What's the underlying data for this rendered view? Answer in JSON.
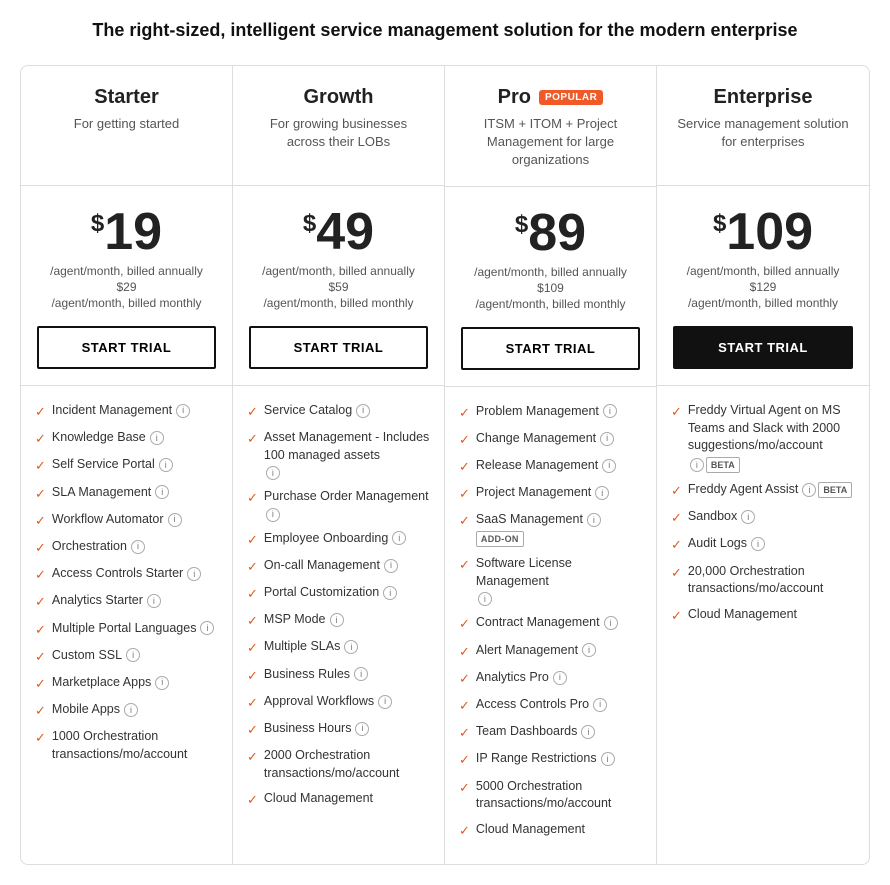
{
  "page": {
    "title": "The right-sized, intelligent service management solution for the modern enterprise"
  },
  "plans": [
    {
      "id": "starter",
      "name": "Starter",
      "popular": false,
      "desc": "For getting started",
      "price": "19",
      "billing_annual": "/agent/month, billed annually",
      "price_monthly": "$29",
      "billing_monthly": "/agent/month, billed monthly",
      "cta": "START TRIAL",
      "cta_dark": false,
      "features": [
        {
          "text": "Incident Management",
          "info": true
        },
        {
          "text": "Knowledge Base",
          "info": true
        },
        {
          "text": "Self Service Portal",
          "info": true
        },
        {
          "text": "SLA Management",
          "info": true
        },
        {
          "text": "Workflow Automator",
          "info": true
        },
        {
          "text": "Orchestration",
          "info": true
        },
        {
          "text": "Access Controls Starter",
          "info": true
        },
        {
          "text": "Analytics Starter",
          "info": true
        },
        {
          "text": "Multiple Portal Languages",
          "info": true
        },
        {
          "text": "Custom SSL",
          "info": true
        },
        {
          "text": "Marketplace Apps",
          "info": true
        },
        {
          "text": "Mobile Apps",
          "info": true
        },
        {
          "text": "1000 Orchestration transactions/mo/account",
          "info": false
        }
      ]
    },
    {
      "id": "growth",
      "name": "Growth",
      "popular": false,
      "desc": "For growing businesses across their LOBs",
      "price": "49",
      "billing_annual": "/agent/month, billed annually",
      "price_monthly": "$59",
      "billing_monthly": "/agent/month, billed monthly",
      "cta": "START TRIAL",
      "cta_dark": false,
      "features": [
        {
          "text": "Service Catalog",
          "info": true
        },
        {
          "text": "Asset Management - Includes 100 managed assets",
          "info": true
        },
        {
          "text": "Purchase Order Management",
          "info": true
        },
        {
          "text": "Employee Onboarding",
          "info": true
        },
        {
          "text": "On-call Management",
          "info": true
        },
        {
          "text": "Portal Customization",
          "info": true
        },
        {
          "text": "MSP Mode",
          "info": true
        },
        {
          "text": "Multiple SLAs",
          "info": true
        },
        {
          "text": "Business Rules",
          "info": true
        },
        {
          "text": "Approval Workflows",
          "info": true
        },
        {
          "text": "Business Hours",
          "info": true
        },
        {
          "text": "2000 Orchestration transactions/mo/account",
          "info": false
        },
        {
          "text": "Cloud Management",
          "info": false
        }
      ]
    },
    {
      "id": "pro",
      "name": "Pro",
      "popular": true,
      "desc": "ITSM + ITOM + Project Management for large organizations",
      "price": "89",
      "billing_annual": "/agent/month, billed annually",
      "price_monthly": "$109",
      "billing_monthly": "/agent/month, billed monthly",
      "cta": "START TRIAL",
      "cta_dark": false,
      "features": [
        {
          "text": "Problem Management",
          "info": true
        },
        {
          "text": "Change Management",
          "info": true
        },
        {
          "text": "Release Management",
          "info": true
        },
        {
          "text": "Project Management",
          "info": true
        },
        {
          "text": "SaaS Management",
          "info": true,
          "addon": "ADD-ON"
        },
        {
          "text": "Software License Management",
          "info": true
        },
        {
          "text": "Contract Management",
          "info": true
        },
        {
          "text": "Alert Management",
          "info": true
        },
        {
          "text": "Analytics Pro",
          "info": true
        },
        {
          "text": "Access Controls Pro",
          "info": true
        },
        {
          "text": "Team Dashboards",
          "info": true
        },
        {
          "text": "IP Range Restrictions",
          "info": true
        },
        {
          "text": "5000 Orchestration transactions/mo/account",
          "info": false
        },
        {
          "text": "Cloud Management",
          "info": false
        }
      ]
    },
    {
      "id": "enterprise",
      "name": "Enterprise",
      "popular": false,
      "desc": "Service management solution for enterprises",
      "price": "109",
      "billing_annual": "/agent/month, billed annually",
      "price_monthly": "$129",
      "billing_monthly": "/agent/month, billed monthly",
      "cta": "START TRIAL",
      "cta_dark": true,
      "features": [
        {
          "text": "Freddy Virtual Agent on MS Teams and Slack with 2000 suggestions/mo/account",
          "info": true,
          "beta": true
        },
        {
          "text": "Freddy Agent Assist",
          "info": true,
          "beta": true
        },
        {
          "text": "Sandbox",
          "info": true
        },
        {
          "text": "Audit Logs",
          "info": true
        },
        {
          "text": "20,000 Orchestration transactions/mo/account",
          "info": false
        },
        {
          "text": "Cloud Management",
          "info": false
        }
      ]
    }
  ]
}
